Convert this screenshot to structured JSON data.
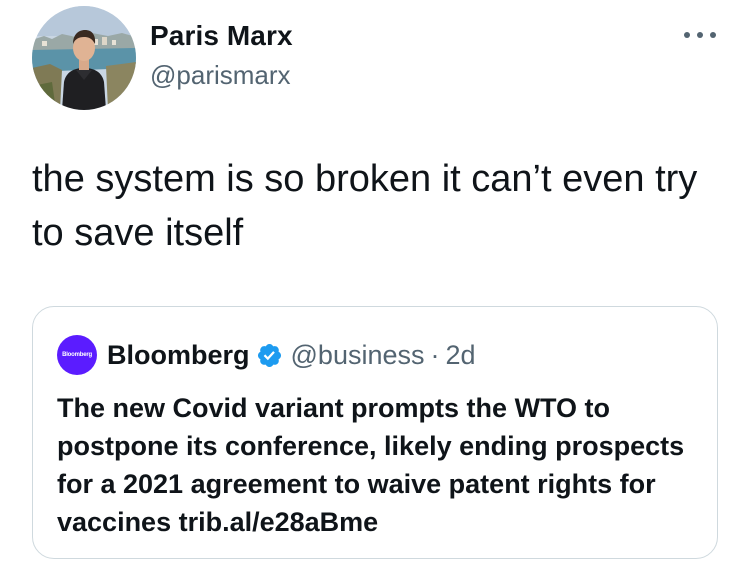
{
  "tweet": {
    "author": {
      "name": "Paris Marx",
      "handle": "@parismarx"
    },
    "more_icon": "more-horizontal-icon",
    "text": "the system is so broken it can’t even try to save itself"
  },
  "quoted_tweet": {
    "author": {
      "name": "Bloomberg",
      "handle": "@business",
      "avatar_text": "Bloomberg",
      "avatar_color": "#5b1cff",
      "verified_icon": "verified-badge-icon",
      "verified_color": "#1d9bf0"
    },
    "separator": "·",
    "time": "2d",
    "text": "The new Covid variant prompts the WTO to postpone its conference, likely ending prospects for a 2021 agreement to waive patent rights for vaccines trib.al/e28aBme"
  },
  "colors": {
    "primary_text": "#0f1419",
    "secondary_text": "#536471",
    "border": "#cfd9de"
  }
}
